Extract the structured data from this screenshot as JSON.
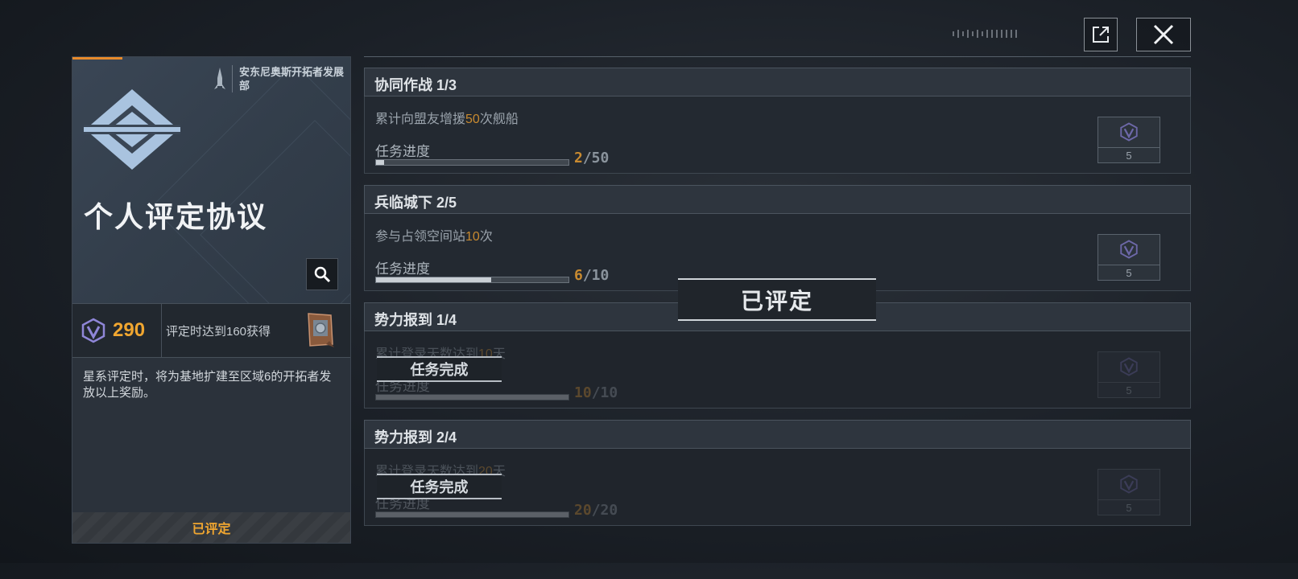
{
  "window": {
    "share_icon": "external-link-icon",
    "close_icon": "close-icon"
  },
  "card": {
    "org_name": "安东尼奥斯开拓者发展部",
    "emblem_icon": "diamond-emblem-icon",
    "title": "个人评定协议",
    "search_icon": "search-icon",
    "reward": {
      "icon": "rating-badge-icon",
      "value": "290",
      "desc": "评定时达到160获得",
      "item_icon": "plaque-item-icon"
    },
    "description": "星系评定时，将为基地扩建至区域6的开拓者发放以上奖励。",
    "status": "已评定"
  },
  "tasks": [
    {
      "title": "协同作战 1/3",
      "desc_pre": "累计向盟友增援",
      "desc_hl": "50",
      "desc_post": "次舰船",
      "progress_label": "任务进度",
      "current": "2",
      "target": "/50",
      "progress": 0.04,
      "reward_icon": "rating-badge-icon",
      "reward_count": "5",
      "completed": false
    },
    {
      "title": "兵临城下 2/5",
      "desc_pre": "参与占领空间站",
      "desc_hl": "10",
      "desc_post": "次",
      "progress_label": "任务进度",
      "current": "6",
      "target": "/10",
      "progress": 0.6,
      "reward_icon": "rating-badge-icon",
      "reward_count": "5",
      "completed": false
    },
    {
      "title": "势力报到 1/4",
      "desc_pre": "累计登录天数达到",
      "desc_hl": "10",
      "desc_post": "天",
      "progress_label": "任务进度",
      "current": "10",
      "target": "/10",
      "progress": 1.0,
      "reward_icon": "rating-badge-icon",
      "reward_count": "5",
      "completed": true,
      "completed_label": "任务完成"
    },
    {
      "title": "势力报到 2/4",
      "desc_pre": "累计登录天数达到",
      "desc_hl": "20",
      "desc_post": "天",
      "progress_label": "任务进度",
      "current": "20",
      "target": "/20",
      "progress": 1.0,
      "reward_icon": "rating-badge-icon",
      "reward_count": "5",
      "completed": true,
      "completed_label": "任务完成"
    }
  ],
  "overlay": {
    "status": "已评定"
  }
}
